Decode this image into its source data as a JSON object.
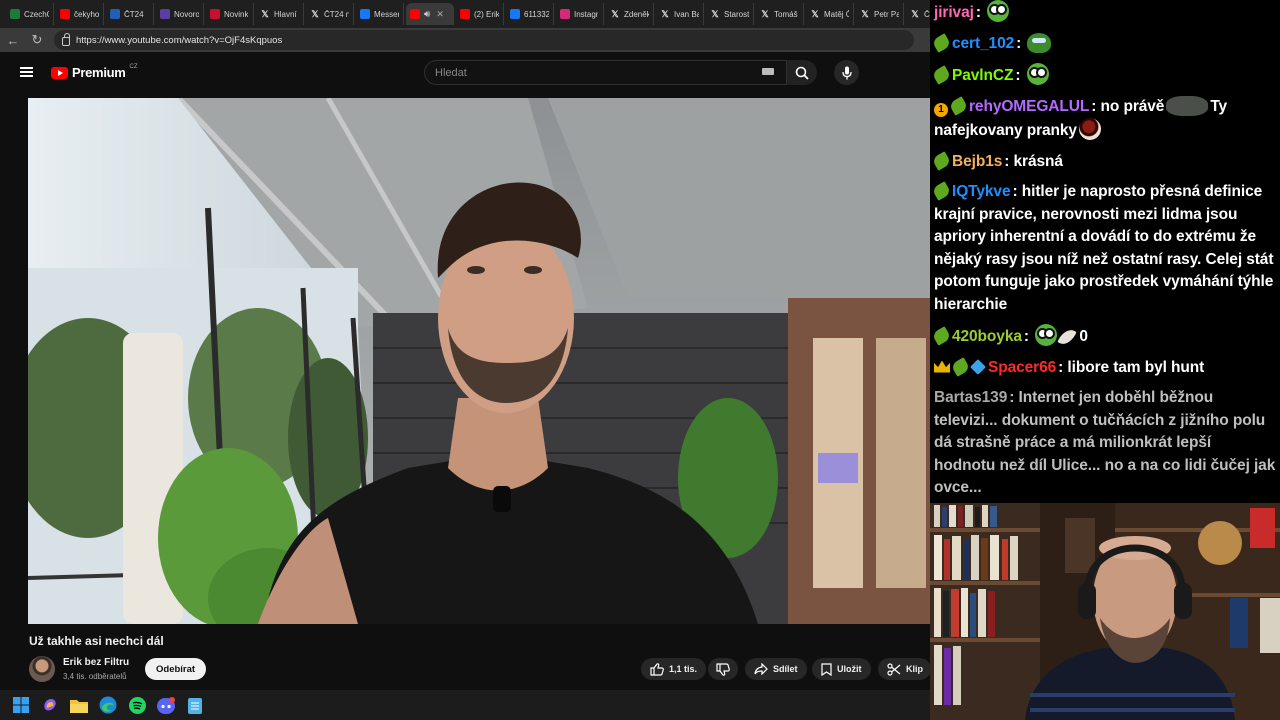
{
  "tabs": [
    {
      "label": "CzechC",
      "icon": "excel-icon",
      "color": "#1d7a3a"
    },
    {
      "label": "čekyho",
      "icon": "youtube-icon",
      "color": "#ff0000"
    },
    {
      "label": "ČT24",
      "icon": "ct24-icon",
      "color": "#1f5fb8"
    },
    {
      "label": "Novoro",
      "icon": "grid-icon",
      "color": "#5b3fa0"
    },
    {
      "label": "Novink",
      "icon": "novinky-icon",
      "color": "#c8102e"
    },
    {
      "label": "Hlavní",
      "icon": "x-icon",
      "color": "#000000"
    },
    {
      "label": "ČT24 n",
      "icon": "x-icon",
      "color": "#000000"
    },
    {
      "label": "Messen",
      "icon": "facebook-icon",
      "color": "#1877f2"
    },
    {
      "label": "",
      "icon": "youtube-icon",
      "color": "#ff0000",
      "active": true
    },
    {
      "label": "(2) Erik",
      "icon": "youtube-icon",
      "color": "#ff0000"
    },
    {
      "label": "611332",
      "icon": "facebook-icon",
      "color": "#1877f2"
    },
    {
      "label": "Instagr",
      "icon": "instagram-icon",
      "color": "#d62976"
    },
    {
      "label": "Zdeněk",
      "icon": "x-icon",
      "color": "#000000"
    },
    {
      "label": "Ivan Ba",
      "icon": "x-icon",
      "color": "#000000"
    },
    {
      "label": "Starost",
      "icon": "x-icon",
      "color": "#000000"
    },
    {
      "label": "Tomáš",
      "icon": "x-icon",
      "color": "#000000"
    },
    {
      "label": "Matěj Č",
      "icon": "x-icon",
      "color": "#000000"
    },
    {
      "label": "Petr Pa",
      "icon": "x-icon",
      "color": "#000000"
    },
    {
      "label": "ČT24",
      "icon": "x-icon",
      "color": "#000000"
    }
  ],
  "address": {
    "url": "https://www.youtube.com/watch?v=OjF4sKqpuos"
  },
  "youtube": {
    "brand": "Premium",
    "region": "CZ",
    "search_placeholder": "Hledat"
  },
  "video": {
    "title": "Už takhle asi nechci dál",
    "channel": "Erik bez Filtru",
    "subscribers": "3,4 tis. odběratelů",
    "subscribe_label": "Odebírat",
    "likes": "1,1 tis.",
    "share_label": "Sdílet",
    "save_label": "Uložit",
    "clip_label": "Klip"
  },
  "taskbar": {
    "icons": [
      "windows-start-icon",
      "copilot-icon",
      "file-explorer-icon",
      "edge-icon",
      "spotify-icon",
      "discord-icon",
      "notepad-icon"
    ]
  },
  "chat": {
    "messages": [
      {
        "user": "jirivaj",
        "color": "#ff69b4",
        "text": "",
        "emotes": [
          "frog"
        ]
      },
      {
        "user": "cert_102",
        "color": "#1e90ff",
        "text": "",
        "emotes": [
          "pepe"
        ],
        "badges": [
          "leaf"
        ]
      },
      {
        "user": "PavlnCZ",
        "color": "#7cfc00",
        "text": "",
        "emotes": [
          "frog"
        ],
        "badges": [
          "leaf"
        ]
      },
      {
        "user": "rehyOMEGALUL",
        "color": "#b36bff",
        "text": "no právě",
        "text2": "Ty nafejkovany pranky",
        "badges": [
          "coin",
          "leaf"
        ]
      },
      {
        "user": "Bejb1s",
        "color": "#f5b05a",
        "text": "krásná",
        "badges": [
          "leaf"
        ]
      },
      {
        "user": "IQTykve",
        "color": "#1e90ff",
        "text": "hitler je naprosto přesná definice krajní pravice, nerovnosti mezi lidma jsou apriory inherentní a dovádí to do extrému že nějaký rasy jsou níž než ostatní rasy. Celej stát potom funguje jako prostředek vymáhání týhle hierarchie",
        "badges": [
          "leaf"
        ]
      },
      {
        "user": "420boyka",
        "color": "#9acd32",
        "text": "0",
        "badges": [
          "leaf"
        ]
      },
      {
        "user": "Spacer66",
        "color": "#ff2a2a",
        "text": "libore tam byl hunt",
        "badges": [
          "crown",
          "leaf",
          "cube"
        ]
      },
      {
        "user": "Bartas139",
        "color": "#a8a8a8",
        "text": "Internet jen doběhl běžnou televizi... dokument o tučňácích z jižního polu dá strašně práce a má milionkrát lepší hodnotu než díl Ulice... no a na co lidi čučej jak ovce..."
      }
    ]
  }
}
